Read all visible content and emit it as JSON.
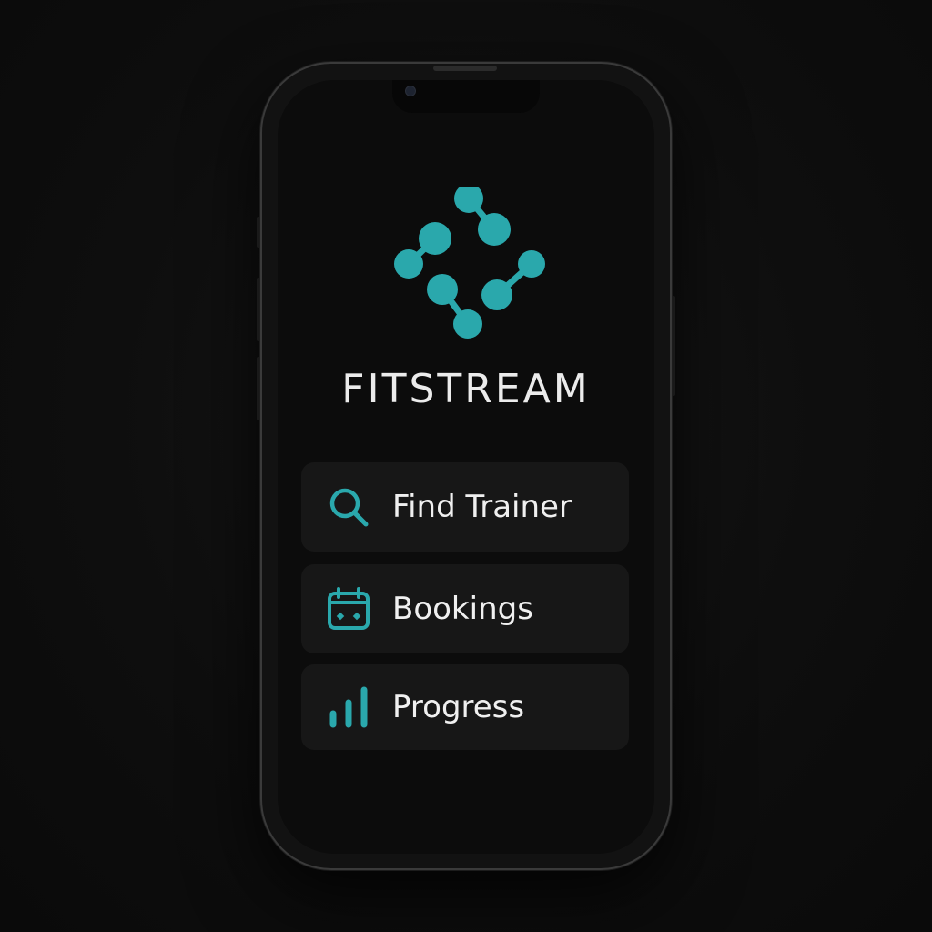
{
  "app": {
    "name": "FITSTREAM",
    "accent_color": "#2aa8ac",
    "logo_icon": "dumbbell-diamond-logo"
  },
  "menu": {
    "items": [
      {
        "label": "Find Trainer",
        "icon": "search-icon"
      },
      {
        "label": "Bookings",
        "icon": "calendar-icon"
      },
      {
        "label": "Progress",
        "icon": "bar-chart-icon"
      }
    ]
  }
}
